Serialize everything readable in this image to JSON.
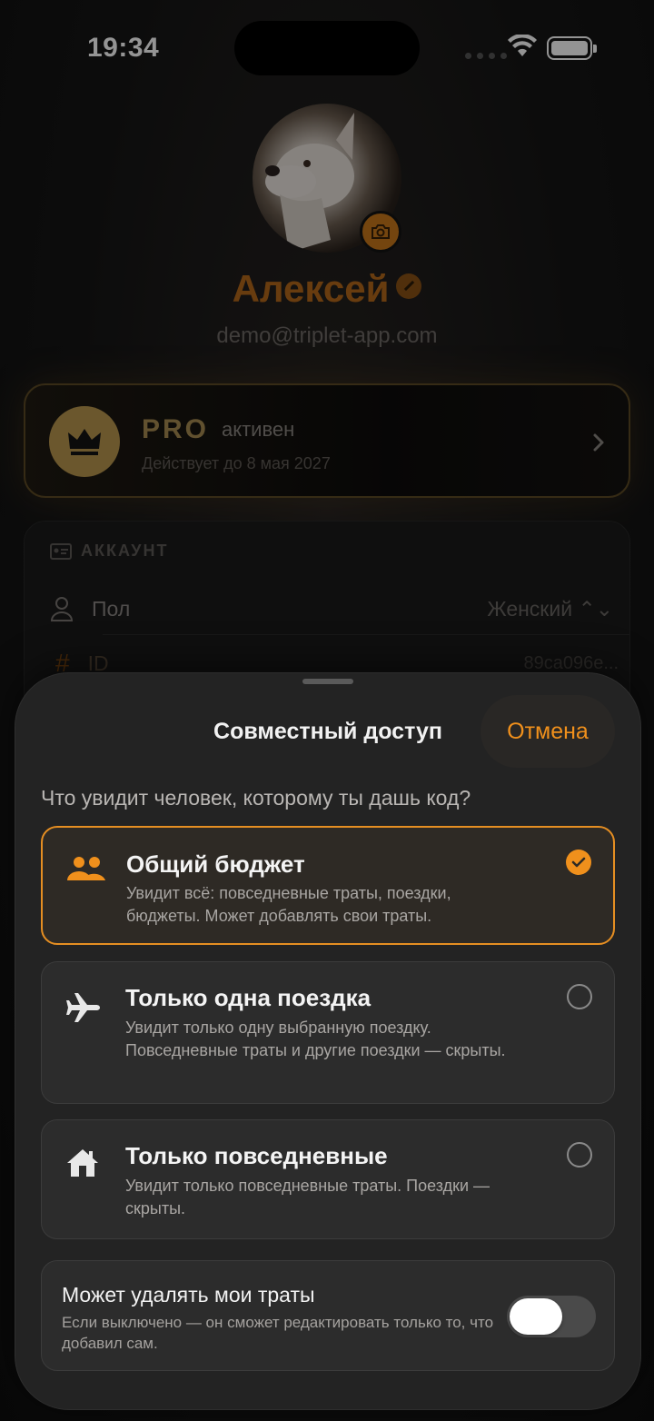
{
  "status_bar": {
    "time": "19:34"
  },
  "profile": {
    "name": "Алексей",
    "email": "demo@triplet-app.com"
  },
  "pro": {
    "label": "PRO",
    "status": "активен",
    "valid_until": "Действует до 8 мая 2027"
  },
  "account": {
    "section_title": "АККАУНТ",
    "rows": [
      {
        "label": "Пол",
        "value": "Женский ⌃⌄"
      },
      {
        "label": "ID",
        "value": "89ca096e..."
      }
    ]
  },
  "sheet": {
    "title": "Совместный доступ",
    "cancel": "Отмена",
    "question": "Что увидит человек, которому ты дашь код?",
    "options": [
      {
        "title": "Общий бюджет",
        "description": "Увидит всё: повседневные траты, поездки, бюджеты. Может добавлять свои траты.",
        "icon": "people-icon",
        "selected": true
      },
      {
        "title": "Только одна поездка",
        "description": "Увидит только одну выбранную поездку. Повседневные траты и другие поездки — скрыты.",
        "icon": "airplane-icon",
        "selected": false
      },
      {
        "title": "Только повседневные",
        "description": "Увидит только повседневные траты. Поездки — скрыты.",
        "icon": "house-icon",
        "selected": false
      }
    ],
    "toggle": {
      "title": "Может удалять мои траты",
      "description": "Если выключено — он сможет редактировать только то, что добавил сам.",
      "on": false
    }
  },
  "colors": {
    "accent": "#f0901c",
    "name": "#b4681a",
    "pro_gold": "#b8964e"
  }
}
